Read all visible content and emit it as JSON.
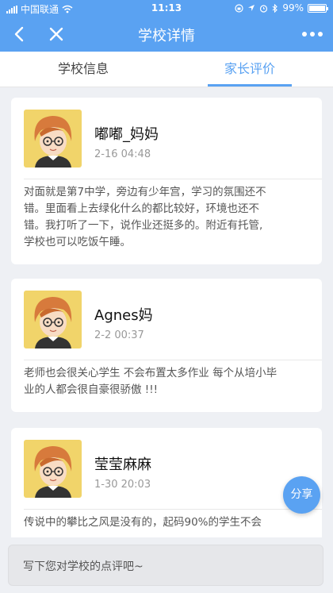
{
  "status": {
    "carrier": "中国联通",
    "time": "11:13",
    "battery": "99%"
  },
  "nav": {
    "title": "学校详情"
  },
  "tabs": [
    {
      "label": "学校信息"
    },
    {
      "label": "家长评价"
    }
  ],
  "reviews": [
    {
      "name": "嘟嘟_妈妈",
      "date": "2-16 04:48",
      "lines": [
        "对面就是第7中学，旁边有少年宫，学习的氛围还不",
        "错。里面看上去绿化什么的都比较好，环境也还不",
        "错。我打听了一下，说作业还挺多的。附近有托管,",
        "学校也可以吃饭午睡。"
      ]
    },
    {
      "name": "Agnes妈",
      "date": "2-2 00:37",
      "lines": [
        "老师也会很关心学生 不会布置太多作业 每个从培小毕",
        "业的人都会很自豪很骄傲 !!!"
      ]
    },
    {
      "name": "莹莹麻麻",
      "date": "1-30 20:03",
      "lines": [
        "传说中的攀比之风是没有的，起码90%的学生不会"
      ]
    }
  ],
  "share_label": "分享",
  "comment_input": {
    "placeholder": "写下您对学校的点评吧~"
  },
  "colors": {
    "accent": "#5aa2f2",
    "background": "#eef0f4"
  }
}
